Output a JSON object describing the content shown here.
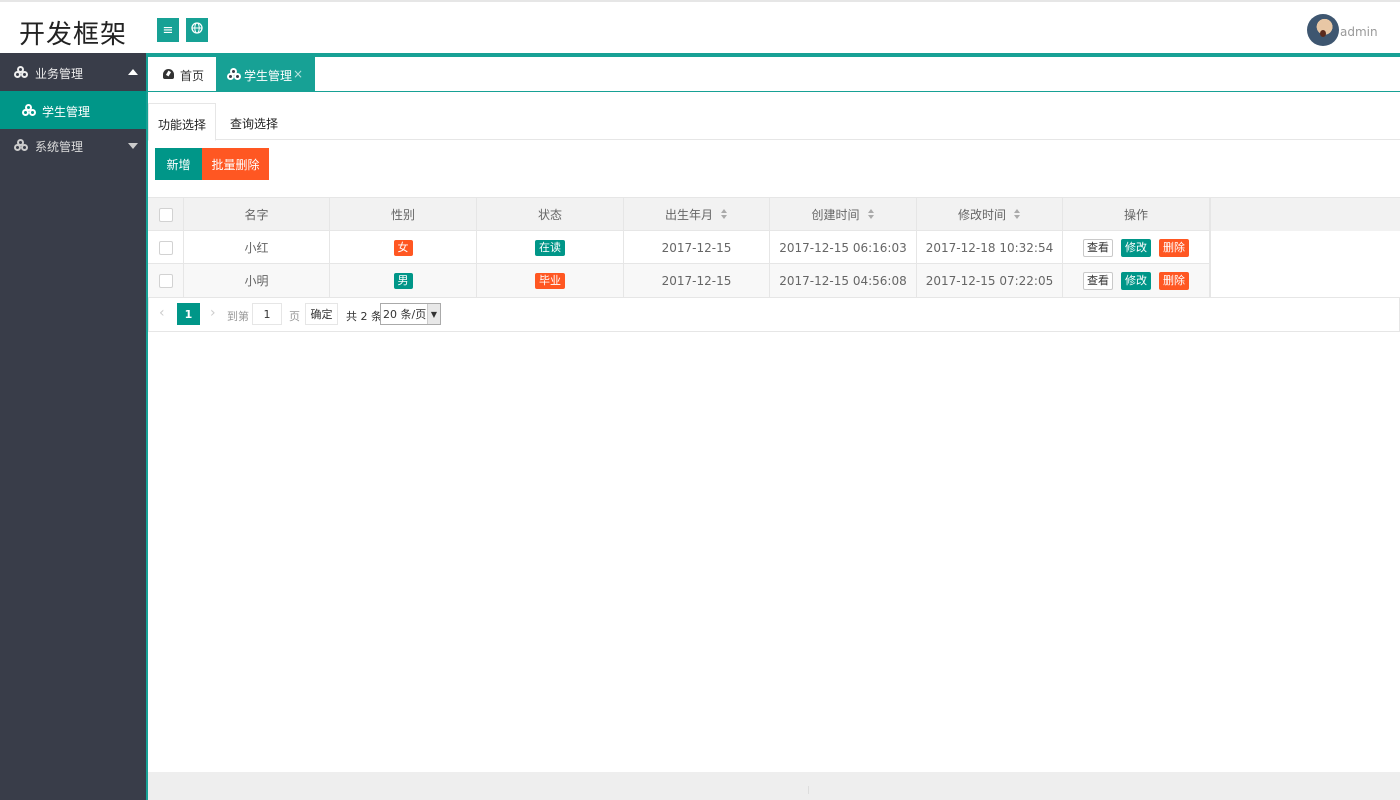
{
  "app": {
    "title": "开发框架",
    "user": "admin"
  },
  "header": {
    "menu_icon": "hamburger-icon",
    "globe_icon": "globe-icon"
  },
  "sidebar": {
    "items": [
      {
        "label": "业务管理",
        "expanded": true
      },
      {
        "label": "学生管理",
        "active": true
      },
      {
        "label": "系统管理",
        "expanded": false
      }
    ]
  },
  "page_tabs": [
    {
      "label": "首页"
    },
    {
      "label": "学生管理",
      "active": true,
      "close": "×"
    }
  ],
  "sub_tabs": [
    {
      "label": "功能选择",
      "active": true
    },
    {
      "label": "查询选择"
    }
  ],
  "toolbar": {
    "add_label": "新增",
    "batch_delete_label": "批量删除"
  },
  "table": {
    "columns": [
      "名字",
      "性别",
      "状态",
      "出生年月",
      "创建时间",
      "修改时间",
      "操作"
    ],
    "rows": [
      {
        "name": "小红",
        "gender": "女",
        "status": "在读",
        "birth": "2017-12-15",
        "created": "2017-12-15 06:16:03",
        "modified": "2017-12-18 10:32:54"
      },
      {
        "name": "小明",
        "gender": "男",
        "status": "毕业",
        "birth": "2017-12-15",
        "created": "2017-12-15 04:56:08",
        "modified": "2017-12-15 07:22:05"
      }
    ],
    "actions": {
      "view": "查看",
      "edit": "修改",
      "delete": "删除"
    }
  },
  "pager": {
    "current": "1",
    "goto_label": "到第",
    "goto_value": "1",
    "page_label": "页",
    "ok_label": "确定",
    "total_label": "共 2 条",
    "page_size": "20 条/页"
  },
  "colors": {
    "accent": "#009688",
    "danger": "#ff5722",
    "sidebar_bg": "#393d49"
  }
}
